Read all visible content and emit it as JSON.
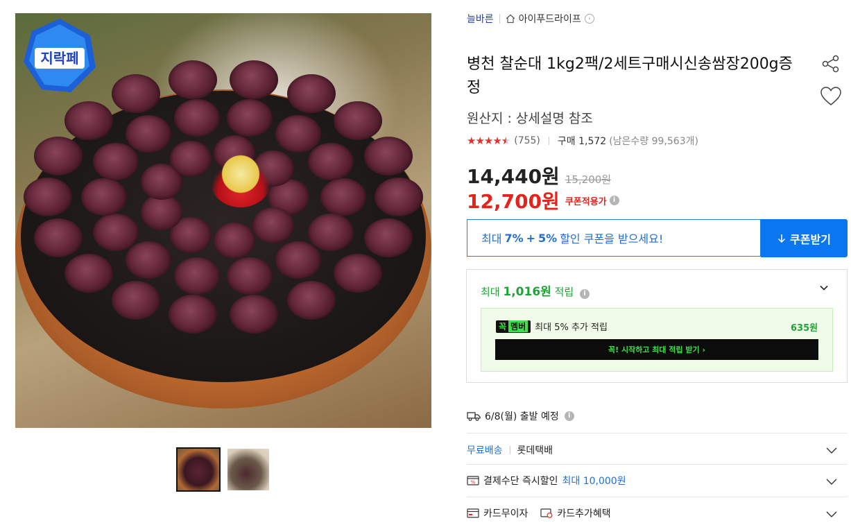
{
  "breadcrumb": {
    "category": "늘바른",
    "shop": "아이푸드라이프"
  },
  "product": {
    "title": "병천 찰순대 1kg2팩/2세트구매시신송쌈장200g증정",
    "origin": "원산지 : 상세설명 참조",
    "rating": {
      "stars": 4.5,
      "stars_text": "★★★★",
      "half_star": "★",
      "empty_star": "★",
      "review_count": "(755)"
    },
    "purchase": "구매 1,572",
    "remaining": "(남은수량 99,563개)"
  },
  "badge": {
    "text": "지락페"
  },
  "price": {
    "sale": "14,440원",
    "original": "15,200원",
    "coupon": "12,700원",
    "coupon_label": "쿠폰적용가"
  },
  "coupon_banner": {
    "prefix": "최대",
    "pct1": "7%",
    "plus": "+",
    "pct2": "5%",
    "suffix": "할인 쿠폰을 받으세요!",
    "button": "쿠폰받기"
  },
  "reward": {
    "prefix": "최대",
    "amount": "1,016원",
    "suffix": "적립",
    "member_logo_a": "꼭",
    "member_logo_b": "멤버",
    "member_text": "최대 5% 추가 적립",
    "member_amount": "635원",
    "member_cta": "꼭! 시작하고 최대 적립 받기 ›"
  },
  "shipping": {
    "date": "6/8(월) 출발 예정"
  },
  "delivery": {
    "type": "무료배송",
    "courier": "롯데택배"
  },
  "payment": {
    "label": "결제수단 즉시할인",
    "max": "최대 10,000원"
  },
  "card": {
    "installment": "카드무이자",
    "extra": "카드추가혜택"
  },
  "icons": [
    "share-icon",
    "heart-icon",
    "home-icon",
    "info-icon",
    "chevron-down-icon",
    "truck-icon",
    "download-icon",
    "payment-icon",
    "card-icon"
  ]
}
